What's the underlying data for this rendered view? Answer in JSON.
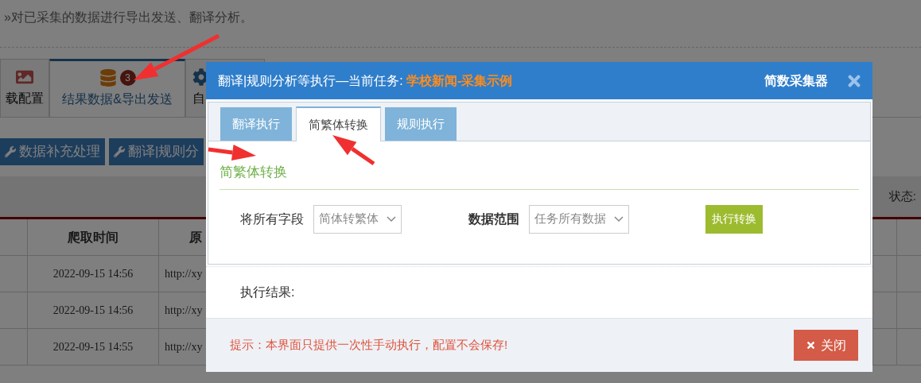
{
  "page": {
    "description": "»对已采集的数据进行导出发送、翻译分析。",
    "tabs": [
      {
        "label": "载配置",
        "selected": false,
        "kind": "image"
      },
      {
        "label": "结果数据&导出发送",
        "selected": true,
        "kind": "database",
        "badge": "3"
      },
      {
        "label": "自",
        "selected": false,
        "kind": "gear"
      }
    ],
    "toolbar": [
      "数据补充处理",
      "翻译|规则分"
    ],
    "status_label": "状态:",
    "table": {
      "columns": [
        {
          "label": "爬取时间"
        },
        {
          "label": "原"
        }
      ],
      "rows": [
        {
          "crawl_time": "2022-09-15 14:56",
          "column_3": "http://xy"
        },
        {
          "crawl_time": "2022-09-15 14:56",
          "column_3": "http://xy"
        },
        {
          "crawl_time": "2022-09-15 14:55",
          "column_3": "http://xy"
        }
      ]
    }
  },
  "dialog": {
    "title": "翻译|规则分析等执行—当前任务: ",
    "task_name": "学校新闻-采集示例",
    "brand": "简数采集器",
    "tabs": [
      {
        "label": "翻译执行",
        "selected": false
      },
      {
        "label": "简繁体转换",
        "selected": true
      },
      {
        "label": "规则执行",
        "selected": false
      }
    ],
    "section_title": "简繁体转换",
    "fields": [
      {
        "label": "将所有字段",
        "bold": false,
        "value": "简体转繁体"
      },
      {
        "label": "数据范围",
        "bold": true,
        "value": "任务所有数据"
      }
    ],
    "run_button": "执行转换",
    "result_label": "执行结果:",
    "hint": "提示：本界面只提供一次性手动执行，配置不会保存!",
    "close_button": "关闭"
  }
}
